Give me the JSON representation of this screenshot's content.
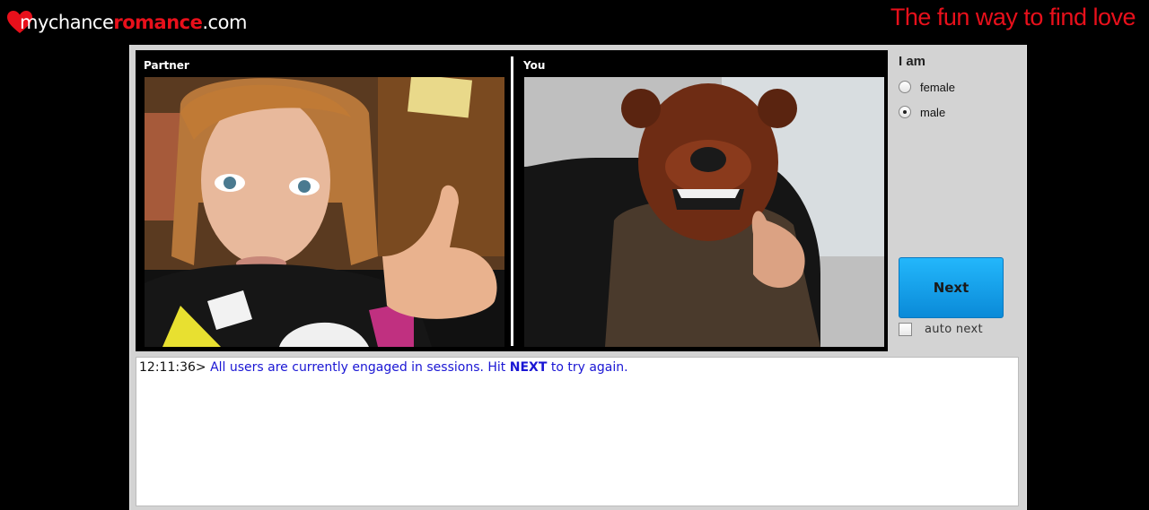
{
  "header": {
    "logo": {
      "my": "my",
      "chance": "chance",
      "romance": "romance",
      "com": ".com"
    },
    "tagline": "The fun way to find love"
  },
  "video": {
    "partner_label": "Partner",
    "you_label": "You"
  },
  "side_panel": {
    "iam_title": "I am",
    "gender_options": [
      {
        "label": "female",
        "selected": false
      },
      {
        "label": "male",
        "selected": true
      }
    ],
    "next_button": "Next",
    "auto_next_label": "auto next",
    "auto_next_checked": false
  },
  "chat_log": {
    "entries": [
      {
        "time": "12:11:36>",
        "message_before": "All users are currently engaged in sessions. Hit",
        "message_strong": "NEXT",
        "message_after": "to try again."
      }
    ]
  },
  "colors": {
    "brand_red": "#e8101b",
    "next_blue": "#1aa7f0",
    "log_blue": "#1a16d4"
  }
}
